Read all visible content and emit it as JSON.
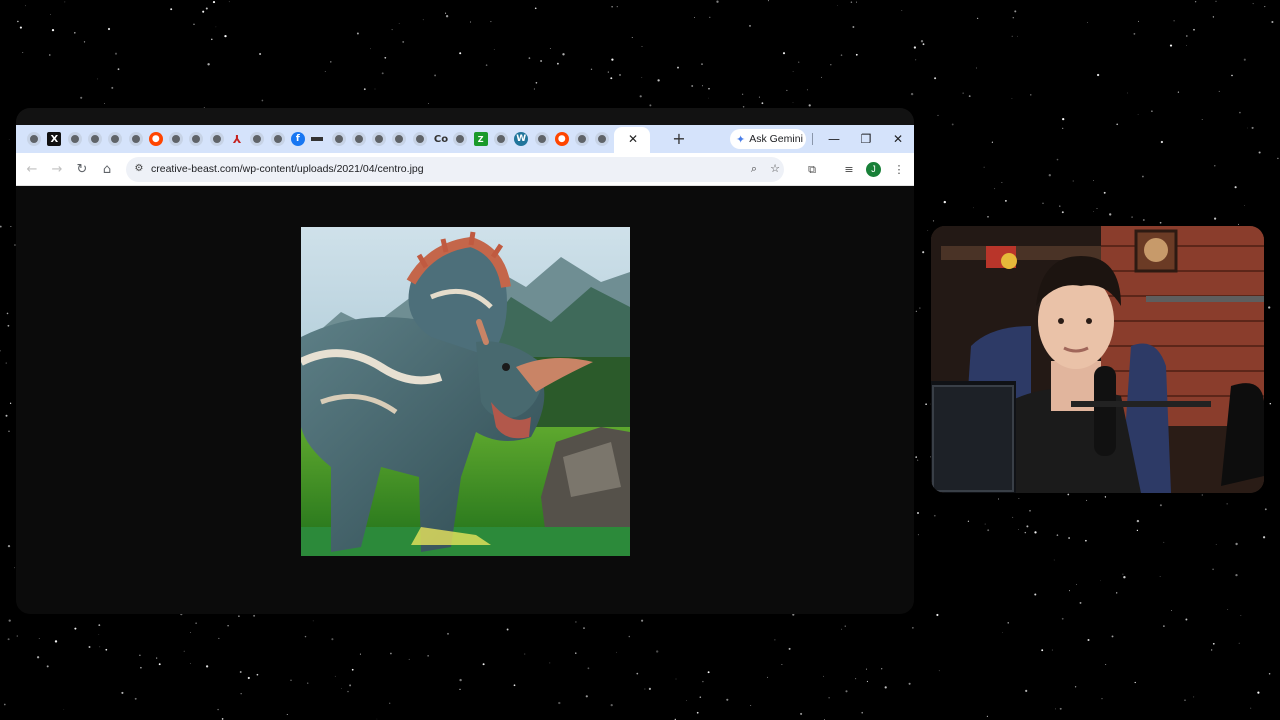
{
  "browser": {
    "tabs": [
      {
        "icon": "globe-icon"
      },
      {
        "icon": "x-logo-icon",
        "glyph": "X"
      },
      {
        "icon": "globe-icon"
      },
      {
        "icon": "globe-icon"
      },
      {
        "icon": "globe-icon"
      },
      {
        "icon": "globe-icon"
      },
      {
        "icon": "reddit-icon"
      },
      {
        "icon": "globe-icon"
      },
      {
        "icon": "globe-icon"
      },
      {
        "icon": "globe-icon"
      },
      {
        "icon": "pdf-icon"
      },
      {
        "icon": "globe-icon"
      },
      {
        "icon": "globe-icon"
      },
      {
        "icon": "facebook-icon",
        "glyph": "f"
      },
      {
        "icon": "bar-icon"
      },
      {
        "icon": "globe-icon"
      },
      {
        "icon": "globe-icon"
      },
      {
        "icon": "globe-icon"
      },
      {
        "icon": "globe-icon"
      },
      {
        "icon": "globe-icon"
      },
      {
        "icon": "co-icon",
        "glyph": "Co"
      },
      {
        "icon": "globe-icon"
      },
      {
        "icon": "green-app-icon",
        "glyph": "Z"
      },
      {
        "icon": "globe-icon"
      },
      {
        "icon": "wordpress-icon",
        "glyph": "W"
      },
      {
        "icon": "globe-icon"
      },
      {
        "icon": "reddit-icon"
      },
      {
        "icon": "globe-icon"
      },
      {
        "icon": "globe-icon"
      }
    ],
    "tab_close_glyph": "✕",
    "new_tab_glyph": "+",
    "gemini_label": "Ask Gemini",
    "window_controls": {
      "minimize": "—",
      "maximize": "❐",
      "close": "✕"
    },
    "url": "creative-beast.com/wp-content/uploads/2021/04/centro.jpg",
    "profile_initial": "J"
  },
  "content": {
    "image_subject": "triceratops-figure-image"
  }
}
